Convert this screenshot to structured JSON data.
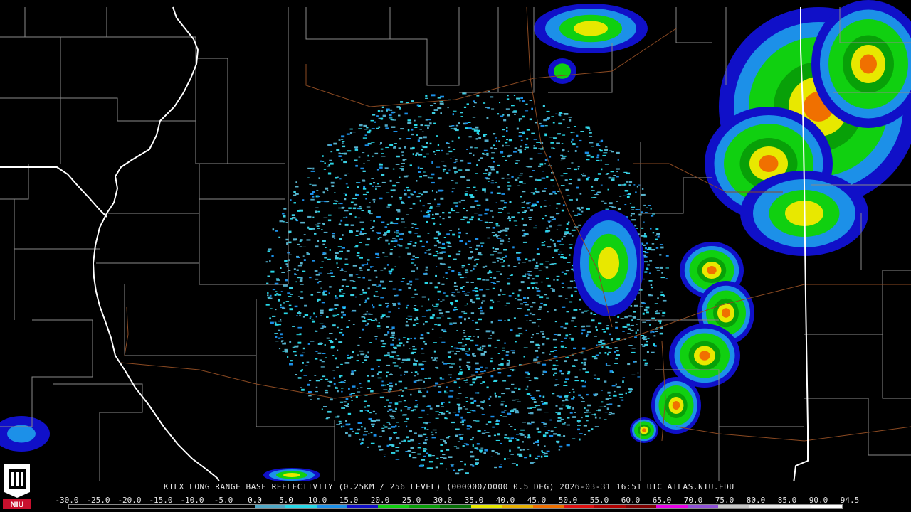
{
  "caption": "KILX LONG RANGE BASE REFLECTIVITY (0.25KM / 256 LEVEL) (000000/0000 0.5 DEG) 2026-03-31 16:51 UTC  ATLAS.NIU.EDU",
  "logo_text": "NIU",
  "scale_labels": [
    "-30.0",
    "-25.0",
    "-20.0",
    "-15.0",
    "-10.0",
    "-5.0",
    "0.0",
    "5.0",
    "10.0",
    "15.0",
    "20.0",
    "25.0",
    "30.0",
    "35.0",
    "40.0",
    "45.0",
    "50.0",
    "55.0",
    "60.0",
    "65.0",
    "70.0",
    "75.0",
    "80.0",
    "85.0",
    "90.0",
    "94.5"
  ],
  "colors": {
    "background": "#000000",
    "county_line": "#8a8a8a",
    "state_line": "#ffffff",
    "interstate": "#8b4a22",
    "radar_site": "#000000"
  },
  "colorbar": [
    "#000000",
    "#000000",
    "#000000",
    "#000000",
    "#000000",
    "#000000",
    "#4fa8c6",
    "#28d8e8",
    "#1c90e8",
    "#1010c8",
    "#10d010",
    "#08a008",
    "#067006",
    "#e8e800",
    "#e8b000",
    "#f07000",
    "#e01010",
    "#b00000",
    "#800000",
    "#e800e8",
    "#9050d8",
    "#c8c8c8",
    "#e8e8e8",
    "#f4f4f4",
    "#ffffff"
  ]
}
